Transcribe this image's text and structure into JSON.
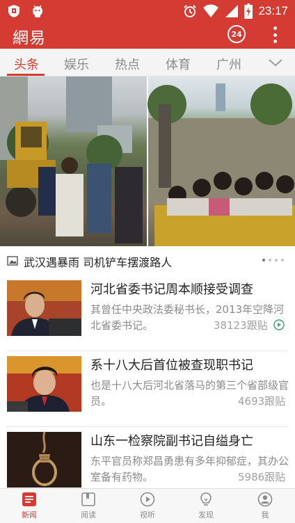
{
  "status_bar": {
    "time": "23:17",
    "left_icons": [
      "shield-icon",
      "android-icon"
    ],
    "right_icons": [
      "alarm-icon",
      "wifi-icon",
      "signal-icon",
      "battery-icon"
    ]
  },
  "app_bar": {
    "title": "網易",
    "badge": "24",
    "badge_icon": "24h-icon",
    "more_icon": "more-vert-icon",
    "color": "#d43c33"
  },
  "tabs": {
    "items": [
      {
        "label": "头条",
        "active": true
      },
      {
        "label": "娱乐",
        "active": false
      },
      {
        "label": "热点",
        "active": false
      },
      {
        "label": "体育",
        "active": false
      },
      {
        "label": "广州",
        "active": false
      }
    ],
    "more_icon": "chevron-down-icon"
  },
  "headline": {
    "caption": "武汉遇暴雨 司机铲车摆渡路人",
    "caption_icon": "gallery-icon",
    "pager_total": 4,
    "pager_active": 1
  },
  "news": [
    {
      "title": "河北省委书记周本顺接受调查",
      "desc": "其曾任中央政法委秘书长，2013年空降河北省委书记。",
      "count": "38123跟贴",
      "extra_icon": "follow-play-icon"
    },
    {
      "title": "系十八大后首位被查现职书记",
      "desc": "也是十八大后河北省落马的第三个省部级官员。",
      "count": "4693跟贴"
    },
    {
      "title": "山东一检察院副书记自缢身亡",
      "desc": "东平官员称郑昌勇患有多年抑郁症，其办公室备有药物。",
      "count": "5986跟贴"
    }
  ],
  "bottom_nav": [
    {
      "label": "新闻",
      "icon": "news-icon",
      "active": true
    },
    {
      "label": "阅读",
      "icon": "book-icon",
      "active": false
    },
    {
      "label": "视听",
      "icon": "play-icon",
      "active": false
    },
    {
      "label": "发现",
      "icon": "bulb-icon",
      "active": false
    },
    {
      "label": "我",
      "icon": "user-icon",
      "active": false
    }
  ]
}
